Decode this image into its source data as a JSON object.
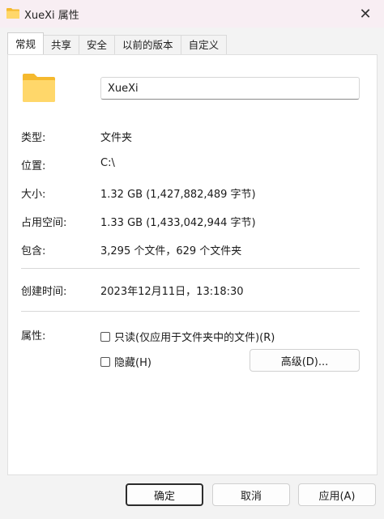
{
  "window": {
    "title": "XueXi 属性",
    "close_glyph": "✕"
  },
  "tabs": [
    "常规",
    "共享",
    "安全",
    "以前的版本",
    "自定义"
  ],
  "general": {
    "folder_name": "XueXi",
    "rows": [
      {
        "label": "类型:",
        "value": "文件夹"
      },
      {
        "label": "位置:",
        "value": "C:\\"
      },
      {
        "label": "大小:",
        "value": "1.32 GB (1,427,882,489 字节)"
      },
      {
        "label": "占用空间:",
        "value": "1.33 GB (1,433,042,944 字节)"
      },
      {
        "label": "包含:",
        "value": "3,295 个文件，629 个文件夹"
      }
    ],
    "created": {
      "label": "创建时间:",
      "value": "2023年12月11日，13:18:30"
    },
    "attributes": {
      "label": "属性:",
      "readonly_label": "只读(仅应用于文件夹中的文件)(R)",
      "readonly_checked": false,
      "hidden_label": "隐藏(H)",
      "hidden_checked": false,
      "advanced_button": "高级(D)..."
    }
  },
  "footer": {
    "ok": "确定",
    "cancel": "取消",
    "apply": "应用(A)"
  },
  "colors": {
    "folder_light": "#ffd76a",
    "folder_dark": "#f5b92e",
    "titlebar_bg": "#f8eef3"
  }
}
